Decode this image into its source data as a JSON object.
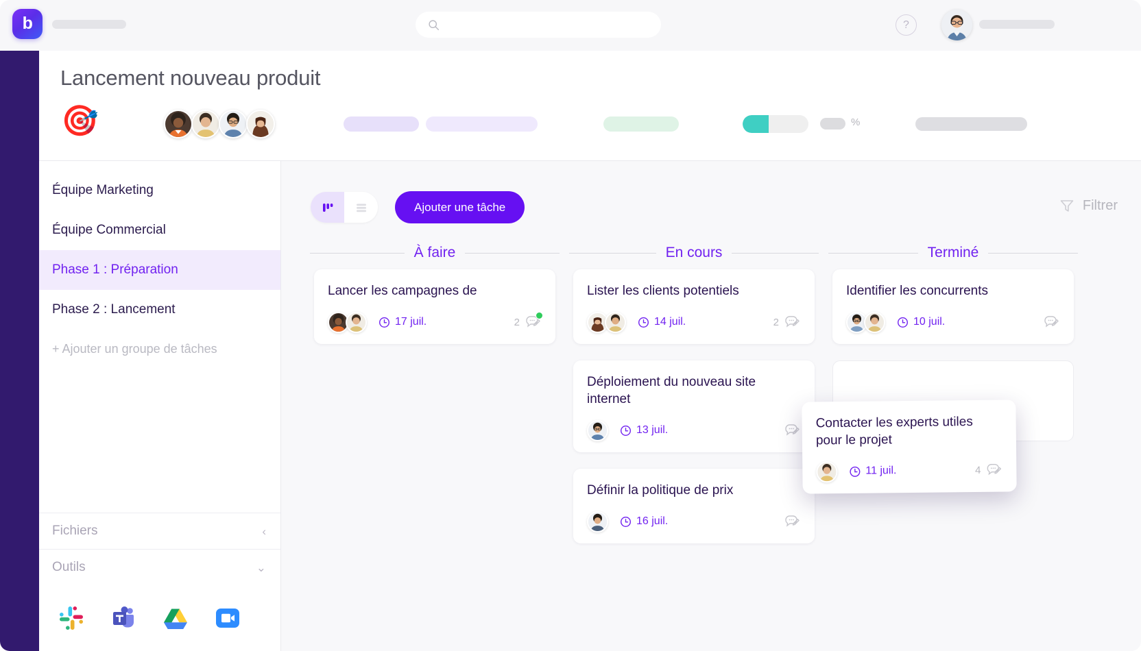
{
  "topnav": {
    "logo_letter": "b",
    "search_placeholder": "",
    "search_value": "",
    "help_label": "?",
    "icons": {
      "search": "search-icon",
      "help": "help-circle-icon",
      "avatar": "user-avatar"
    }
  },
  "project": {
    "title": "Lancement nouveau produit",
    "emoji": "🎯",
    "progress_percent": 40,
    "percent_symbol": "%",
    "member_count": 4
  },
  "sidebar": {
    "items": [
      {
        "label": "Équipe Marketing",
        "active": false
      },
      {
        "label": "Équipe Commercial",
        "active": false
      },
      {
        "label": "Phase 1 : Préparation",
        "active": true
      },
      {
        "label": "Phase 2 : Lancement",
        "active": false
      }
    ],
    "add_group_label": "+ Ajouter un groupe de tâches",
    "files_label": "Fichiers",
    "tools_label": "Outils",
    "tools": [
      {
        "name": "slack-icon",
        "label": "Slack"
      },
      {
        "name": "microsoft-teams-icon",
        "label": "Microsoft Teams"
      },
      {
        "name": "google-drive-icon",
        "label": "Google Drive"
      },
      {
        "name": "zoom-icon",
        "label": "Zoom"
      }
    ]
  },
  "toolbar": {
    "view_board_label": "board-view",
    "view_list_label": "list-view",
    "active_view": "board",
    "add_task_label": "Ajouter une tâche",
    "filter_label": "Filtrer"
  },
  "board": {
    "columns": [
      {
        "title": "À faire",
        "cards": [
          {
            "title": "Lancer les campagnes de",
            "due": "17 juil.",
            "avatars": 2,
            "comments": "2",
            "has_unread": true
          }
        ]
      },
      {
        "title": "En cours",
        "cards": [
          {
            "title": "Lister les clients potentiels",
            "due": "14 juil.",
            "avatars": 2,
            "comments": "2",
            "has_unread": false
          },
          {
            "title": "Déploiement du nouveau site internet",
            "due": "13 juil.",
            "avatars": 1,
            "comments": "",
            "has_unread": false
          },
          {
            "title": "Définir la politique de prix",
            "due": "16 juil.",
            "avatars": 1,
            "comments": "",
            "has_unread": false
          }
        ]
      },
      {
        "title": "Terminé",
        "cards": [
          {
            "title": "Identifier les concurrents",
            "due": "10 juil.",
            "avatars": 2,
            "comments": "",
            "has_unread": false
          }
        ]
      }
    ],
    "dragging_card": {
      "title": "Contacter les experts utiles pour le projet",
      "due": "11 juil.",
      "avatars": 1,
      "comments": "4",
      "has_unread": false
    }
  },
  "colors": {
    "accent_purple": "#6610f2",
    "title_purple": "#7122f0",
    "rail_dark": "#321a6e",
    "progress_teal": "#3fcfc3",
    "unread_green": "#2fcc5c",
    "card_text": "#2a1350"
  }
}
